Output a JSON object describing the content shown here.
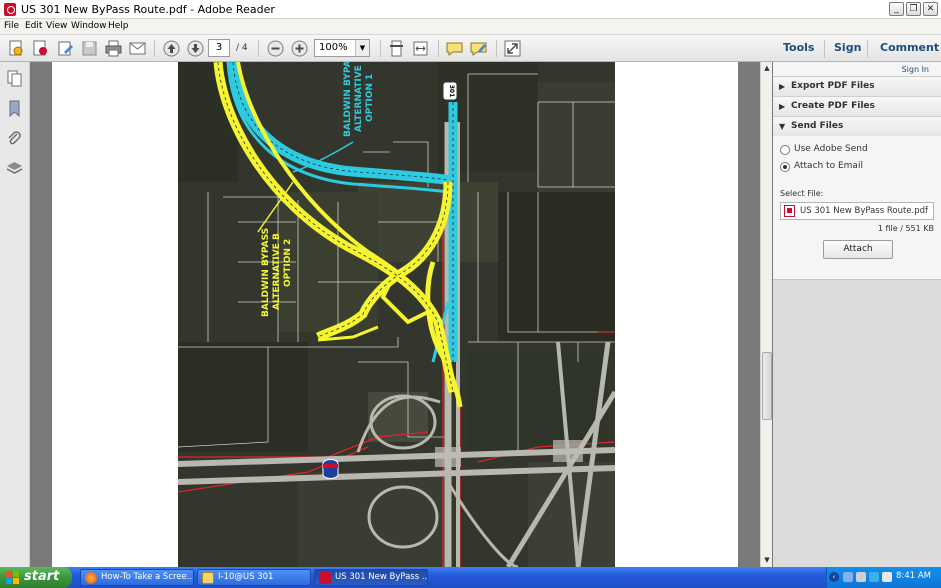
{
  "window": {
    "title": "US 301 New ByPass Route.pdf - Adobe Reader",
    "controls": {
      "minimize": "_",
      "restore": "❐",
      "close": "✕"
    }
  },
  "menu": [
    "File",
    "Edit",
    "View",
    "Window",
    "Help"
  ],
  "toolbar": {
    "current_page": "3",
    "page_count": "/ 4",
    "zoom": "100%",
    "links": [
      "Tools",
      "Sign",
      "Comment"
    ]
  },
  "map": {
    "labels": {
      "alt_b_line1": "BALDWIN BYPASS",
      "alt_b_line2": "ALTERNATIVE B",
      "alt_b_line3": "OPTION 2",
      "alt_c_line1": "BALDWIN BYPASS",
      "alt_c_line2": "ALTERNATIVE",
      "alt_c_line3": "OPTION 1",
      "route_shield": "301"
    }
  },
  "right_pane": {
    "sign_in": "Sign In",
    "sections": [
      {
        "label": "Export PDF Files",
        "state": "collapsed"
      },
      {
        "label": "Create PDF Files",
        "state": "collapsed"
      },
      {
        "label": "Send Files",
        "state": "expanded"
      }
    ],
    "send_options": [
      {
        "label": "Use Adobe Send",
        "selected": false
      },
      {
        "label": "Attach to Email",
        "selected": true
      }
    ],
    "select_file_label": "Select File:",
    "file_name": "US 301 New ByPass Route.pdf",
    "file_info": "1 file / 551 KB",
    "attach_label": "Attach"
  },
  "taskbar": {
    "start_label": "start",
    "tasks": [
      {
        "label": "How-To Take a Scree...",
        "active": false,
        "icon": "firefox-icon"
      },
      {
        "label": "I-10@US 301",
        "active": false,
        "icon": "folder-icon"
      },
      {
        "label": "US 301 New ByPass ...",
        "active": true,
        "icon": "adobe-reader-icon"
      }
    ],
    "clock": "8:41 AM"
  },
  "colors": {
    "route_yellow": "#f5f531",
    "route_cyan": "#2ecbe0",
    "parcel_line": "#e8e8e8",
    "row_red": "#d8262a",
    "accent_blue": "#1d4d7a"
  }
}
